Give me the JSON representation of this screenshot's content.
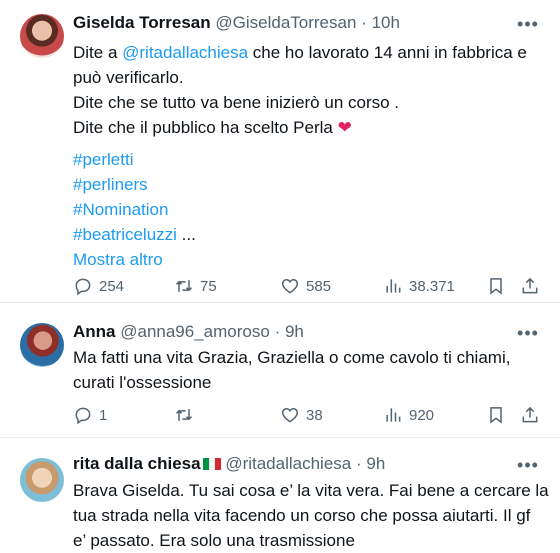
{
  "tweets": [
    {
      "name": "Giselda Torresan",
      "handle": "@GiseldaTorresan",
      "separator": "·",
      "time": "10h",
      "lines": [
        {
          "pre": "Dite a ",
          "mention": "@ritadallachiesa",
          "post": "  che ho lavorato 14 anni in fabbrica e"
        },
        {
          "text": "può verificarlo."
        },
        {
          "text": "Dite che se tutto va bene inizierò un corso ."
        },
        {
          "text": "Dite che il pubblico ha scelto Perla ",
          "emoji": "❤"
        }
      ],
      "hashtags": [
        "#perletti",
        "#perliners",
        "#Nomination",
        "#beatriceluzzi"
      ],
      "hashtag_trailing": " ...",
      "show_more": "Mostra altro",
      "replies": "254",
      "retweets": "75",
      "likes": "585",
      "views": "38.371"
    },
    {
      "name": "Anna",
      "handle": "@anna96_amoroso",
      "separator": "·",
      "time": "9h",
      "lines": [
        {
          "text": "Ma fatti una vita Grazia, Graziella o come cavolo ti chiami,"
        },
        {
          "text": "curati l'ossessione"
        }
      ],
      "replies": "1",
      "retweets": "",
      "likes": "38",
      "views": "920"
    },
    {
      "name": "rita dalla chiesa",
      "handle": "@ritadallachiesa",
      "separator": "·",
      "time": "9h",
      "flag_colors": [
        "#009246",
        "#ffffff",
        "#ce2b37"
      ],
      "lines": [
        {
          "text": "Brava Giselda. Tu sai cosa e’ la vita vera. Fai bene a cercare la"
        },
        {
          "text": "tua strada nella vita facendo un corso che possa aiutarti. Il gf"
        },
        {
          "text": "e’ passato. Era solo una trasmissione"
        }
      ]
    }
  ],
  "more_icon": "more-horizontal-icon"
}
